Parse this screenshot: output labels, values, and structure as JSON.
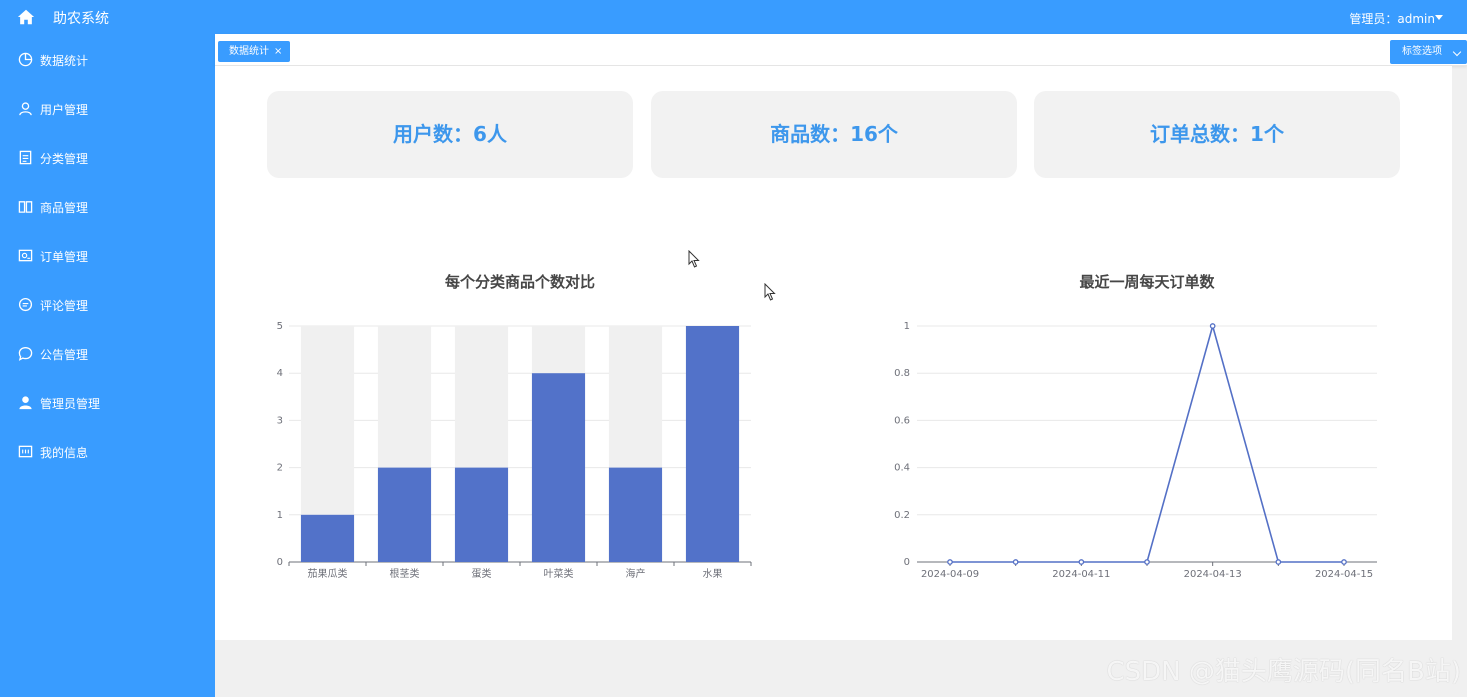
{
  "app": {
    "title": "助农系统",
    "user_label": "管理员：admin"
  },
  "sidebar": {
    "items": [
      {
        "label": "数据统计",
        "icon": "pie-chart-icon"
      },
      {
        "label": "用户管理",
        "icon": "user-icon"
      },
      {
        "label": "分类管理",
        "icon": "document-icon"
      },
      {
        "label": "商品管理",
        "icon": "book-icon"
      },
      {
        "label": "订单管理",
        "icon": "order-icon"
      },
      {
        "label": "评论管理",
        "icon": "comment-icon"
      },
      {
        "label": "公告管理",
        "icon": "chat-bubble-icon"
      },
      {
        "label": "管理员管理",
        "icon": "admin-user-icon"
      },
      {
        "label": "我的信息",
        "icon": "info-card-icon"
      }
    ]
  },
  "tabs": {
    "active": "数据统计",
    "close": "×",
    "options": "标签选项"
  },
  "stats": [
    {
      "text": "用户数：6人"
    },
    {
      "text": "商品数：16个"
    },
    {
      "text": "订单总数：1个"
    }
  ],
  "colors": {
    "primary": "#399cff",
    "stat_text": "#3d97ec",
    "bar": "#5272c9",
    "bar_bg": "#f0f0f0",
    "line": "#5470c6"
  },
  "chart_data": [
    {
      "type": "bar",
      "title": "每个分类商品个数对比",
      "categories": [
        "茄果瓜类",
        "根茎类",
        "蛋类",
        "叶菜类",
        "海产",
        "水果"
      ],
      "values": [
        1,
        2,
        2,
        4,
        2,
        5
      ],
      "ylim": [
        0,
        5
      ],
      "yticks": [
        0,
        1,
        2,
        3,
        4,
        5
      ],
      "background_bars": true
    },
    {
      "type": "line",
      "title": "最近一周每天订单数",
      "x": [
        "2024-04-09",
        "2024-04-10",
        "2024-04-11",
        "2024-04-12",
        "2024-04-13",
        "2024-04-14",
        "2024-04-15"
      ],
      "values": [
        0,
        0,
        0,
        0,
        1,
        0,
        0
      ],
      "xticks": [
        "2024-04-09",
        "2024-04-11",
        "2024-04-13",
        "2024-04-15"
      ],
      "ylim": [
        0,
        1
      ],
      "yticks": [
        0,
        0.2,
        0.4,
        0.6,
        0.8,
        1
      ]
    }
  ],
  "watermark": "CSDN @猫头鹰源码(同名B站)"
}
